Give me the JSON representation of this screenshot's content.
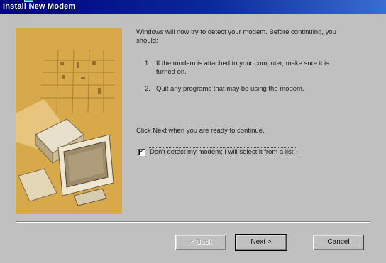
{
  "window": {
    "title": "Install New Modem"
  },
  "content": {
    "intro": "Windows will now try to detect your modem. Before continuing, you should:",
    "steps": [
      {
        "num": "1.",
        "text": "If the modem is attached to your computer, make sure it is turned on."
      },
      {
        "num": "2.",
        "text": "Quit any programs that may be using the modem."
      }
    ],
    "continue_text": "Click Next when you are ready to continue.",
    "checkbox": {
      "label": "Don't detect my modem; I will select it from a list.",
      "checked": true,
      "mark": "✓"
    }
  },
  "buttons": {
    "back": "< Back",
    "next": "Next >",
    "cancel": "Cancel"
  },
  "colors": {
    "titlebar": "#00007f",
    "picture_background": "#d7a94b",
    "dialog_background": "#c0c0c0"
  }
}
